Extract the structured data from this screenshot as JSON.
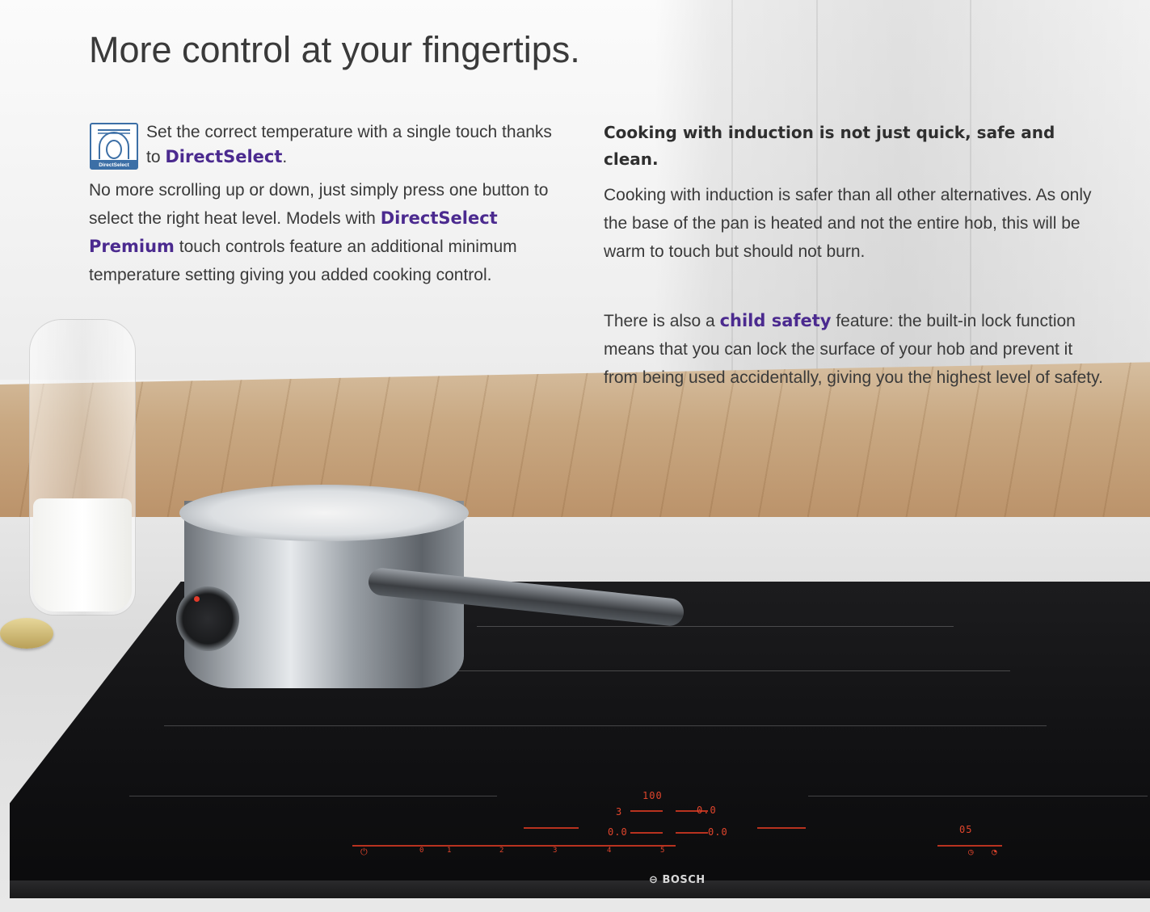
{
  "heading": "More control at your fingertips.",
  "direct_select": {
    "icon_caption": "DirectSelect",
    "lead_before": "Set the correct temperature with a single touch thanks to ",
    "lead_highlight": "DirectSelect",
    "lead_after": ".",
    "body_before": "No more scrolling up or down, just simply press one button to select the right heat level. Models with ",
    "body_highlight": "DirectSelect Premium",
    "body_after": " touch controls feature an additional minimum temperature setting giving you added cooking control."
  },
  "induction": {
    "heading": "Cooking with induction is not just quick, safe and clean.",
    "para1": "Cooking with induction is safer than all other alternatives. As only the base of the pan is heated and not the entire hob, this will be warm to touch but should not burn.",
    "para2_before": "There is also a ",
    "para2_highlight": "child safety",
    "para2_after": " feature: the built-in lock function means that you can lock the surface of your hob and prevent it from being used accidentally, giving you the highest level of safety."
  },
  "hob_display": {
    "temperature": "100",
    "level": "3",
    "value_a": "0.0",
    "value_b": "0.0",
    "value_c": "0.0",
    "value_d": "0.0",
    "timer": "05",
    "scale": [
      "0",
      "1",
      "2",
      "3",
      "4",
      "5"
    ],
    "brand": "BOSCH"
  },
  "colors": {
    "highlight": "#4b2a8f",
    "text": "#3a3a3a",
    "hob_display": "#e0452c"
  }
}
